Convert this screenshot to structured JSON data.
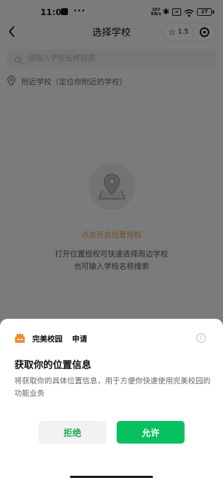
{
  "status_bar": {
    "time": "11:04",
    "more": "···",
    "network_speed_value": "307",
    "network_speed_unit": "KB/s",
    "battery": "27"
  },
  "nav": {
    "title": "选择学校",
    "rating": "1.5"
  },
  "search": {
    "placeholder": "请输入学校名称搜索"
  },
  "nearby": {
    "label": "附近学校（定位你附近的学校）"
  },
  "empty_state": {
    "auth_link": "点击开启位置授权",
    "hint_line1": "打开位置授权可快速选择周边学校",
    "hint_line2": "也可输入学校名称搜索"
  },
  "permission_sheet": {
    "app_name": "完美校园",
    "apply": "申请",
    "info_glyph": "i",
    "title": "获取你的位置信息",
    "description": "将获取你的具体位置信息，用于方便你快速使用完美校园的功能业务",
    "deny_label": "拒绝",
    "allow_label": "允许"
  },
  "colors": {
    "accent_green": "#07c160",
    "auth_link_orange": "#e99c49",
    "logo_orange": "#f08c2c"
  }
}
